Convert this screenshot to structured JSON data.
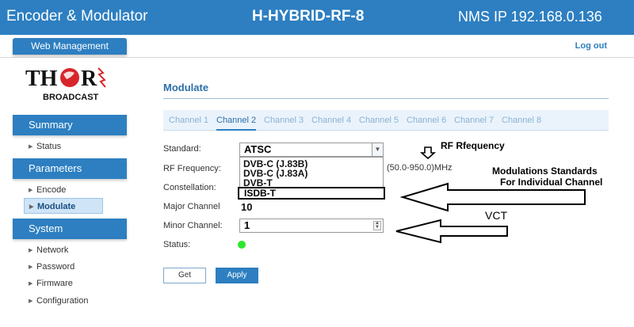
{
  "header": {
    "app_title": "Encoder & Modulator",
    "device_name": "H-HYBRID-RF-8",
    "nms_ip": "NMS IP 192.168.0.136"
  },
  "topbar": {
    "web_management": "Web Management",
    "logout": "Log out"
  },
  "logo": {
    "brand": "THOR",
    "sub": "BROADCAST"
  },
  "sidebar": {
    "summary": {
      "label": "Summary",
      "items": [
        {
          "label": "Status"
        }
      ]
    },
    "parameters": {
      "label": "Parameters",
      "items": [
        {
          "label": "Encode"
        },
        {
          "label": "Modulate"
        }
      ]
    },
    "system": {
      "label": "System",
      "items": [
        {
          "label": "Network"
        },
        {
          "label": "Password"
        },
        {
          "label": "Firmware"
        },
        {
          "label": "Configuration"
        }
      ]
    }
  },
  "main": {
    "title": "Modulate",
    "tabs": [
      "Channel 1",
      "Channel 2",
      "Channel 3",
      "Channel 4",
      "Channel 5",
      "Channel 6",
      "Channel 7",
      "Channel 8"
    ],
    "active_tab": "Channel 2",
    "labels": {
      "standard": "Standard:",
      "rf_frequency": "RF Frequency:",
      "constellation": "Constellation:",
      "major_channel": "Major Channel",
      "minor_channel": "Minor Channel:",
      "status": "Status:"
    },
    "standard": {
      "selected": "ATSC",
      "options": [
        "DVB-C (J.83B)",
        "DVB-C (J.83A)",
        "DVB-T",
        "ISDB-T"
      ]
    },
    "rf_range_hint": "(50.0-950.0)MHz",
    "major_channel_value": "10",
    "minor_channel_value": "1",
    "status_color": "#2ee62e",
    "buttons": {
      "get": "Get",
      "apply": "Apply"
    }
  },
  "annotations": {
    "rf_frequency": "RF Rfequency",
    "modulations_line1": "Modulations Standards",
    "modulations_line2": "For Individual Channel",
    "vct": "VCT"
  },
  "colors": {
    "brand_blue": "#2d7fc1",
    "logo_red": "#d6262b"
  }
}
